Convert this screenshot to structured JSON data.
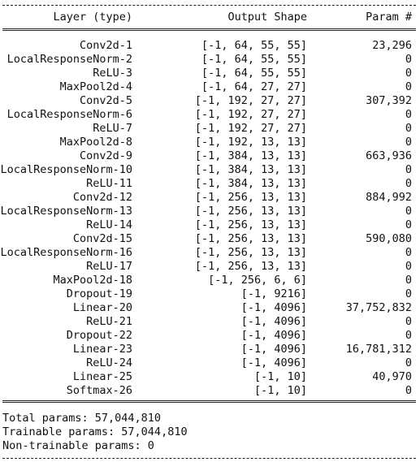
{
  "header": {
    "layer": "Layer (type)",
    "shape": "Output Shape",
    "params": "Param #"
  },
  "rows": [
    {
      "layer": "Conv2d-1",
      "shape": "[-1, 64, 55, 55]",
      "params": "23,296"
    },
    {
      "layer": "LocalResponseNorm-2",
      "shape": "[-1, 64, 55, 55]",
      "params": "0"
    },
    {
      "layer": "ReLU-3",
      "shape": "[-1, 64, 55, 55]",
      "params": "0"
    },
    {
      "layer": "MaxPool2d-4",
      "shape": "[-1, 64, 27, 27]",
      "params": "0"
    },
    {
      "layer": "Conv2d-5",
      "shape": "[-1, 192, 27, 27]",
      "params": "307,392"
    },
    {
      "layer": "LocalResponseNorm-6",
      "shape": "[-1, 192, 27, 27]",
      "params": "0"
    },
    {
      "layer": "ReLU-7",
      "shape": "[-1, 192, 27, 27]",
      "params": "0"
    },
    {
      "layer": "MaxPool2d-8",
      "shape": "[-1, 192, 13, 13]",
      "params": "0"
    },
    {
      "layer": "Conv2d-9",
      "shape": "[-1, 384, 13, 13]",
      "params": "663,936"
    },
    {
      "layer": "LocalResponseNorm-10",
      "shape": "[-1, 384, 13, 13]",
      "params": "0"
    },
    {
      "layer": "ReLU-11",
      "shape": "[-1, 384, 13, 13]",
      "params": "0"
    },
    {
      "layer": "Conv2d-12",
      "shape": "[-1, 256, 13, 13]",
      "params": "884,992"
    },
    {
      "layer": "LocalResponseNorm-13",
      "shape": "[-1, 256, 13, 13]",
      "params": "0"
    },
    {
      "layer": "ReLU-14",
      "shape": "[-1, 256, 13, 13]",
      "params": "0"
    },
    {
      "layer": "Conv2d-15",
      "shape": "[-1, 256, 13, 13]",
      "params": "590,080"
    },
    {
      "layer": "LocalResponseNorm-16",
      "shape": "[-1, 256, 13, 13]",
      "params": "0"
    },
    {
      "layer": "ReLU-17",
      "shape": "[-1, 256, 13, 13]",
      "params": "0"
    },
    {
      "layer": "MaxPool2d-18",
      "shape": "[-1, 256, 6, 6]",
      "params": "0"
    },
    {
      "layer": "Dropout-19",
      "shape": "[-1, 9216]",
      "params": "0"
    },
    {
      "layer": "Linear-20",
      "shape": "[-1, 4096]",
      "params": "37,752,832"
    },
    {
      "layer": "ReLU-21",
      "shape": "[-1, 4096]",
      "params": "0"
    },
    {
      "layer": "Dropout-22",
      "shape": "[-1, 4096]",
      "params": "0"
    },
    {
      "layer": "Linear-23",
      "shape": "[-1, 4096]",
      "params": "16,781,312"
    },
    {
      "layer": "ReLU-24",
      "shape": "[-1, 4096]",
      "params": "0"
    },
    {
      "layer": "Linear-25",
      "shape": "[-1, 10]",
      "params": "40,970"
    },
    {
      "layer": "Softmax-26",
      "shape": "[-1, 10]",
      "params": "0"
    }
  ],
  "footer": {
    "total": "Total params: 57,044,810",
    "trainable": "Trainable params: 57,044,810",
    "non_trainable": "Non-trainable params: 0"
  }
}
